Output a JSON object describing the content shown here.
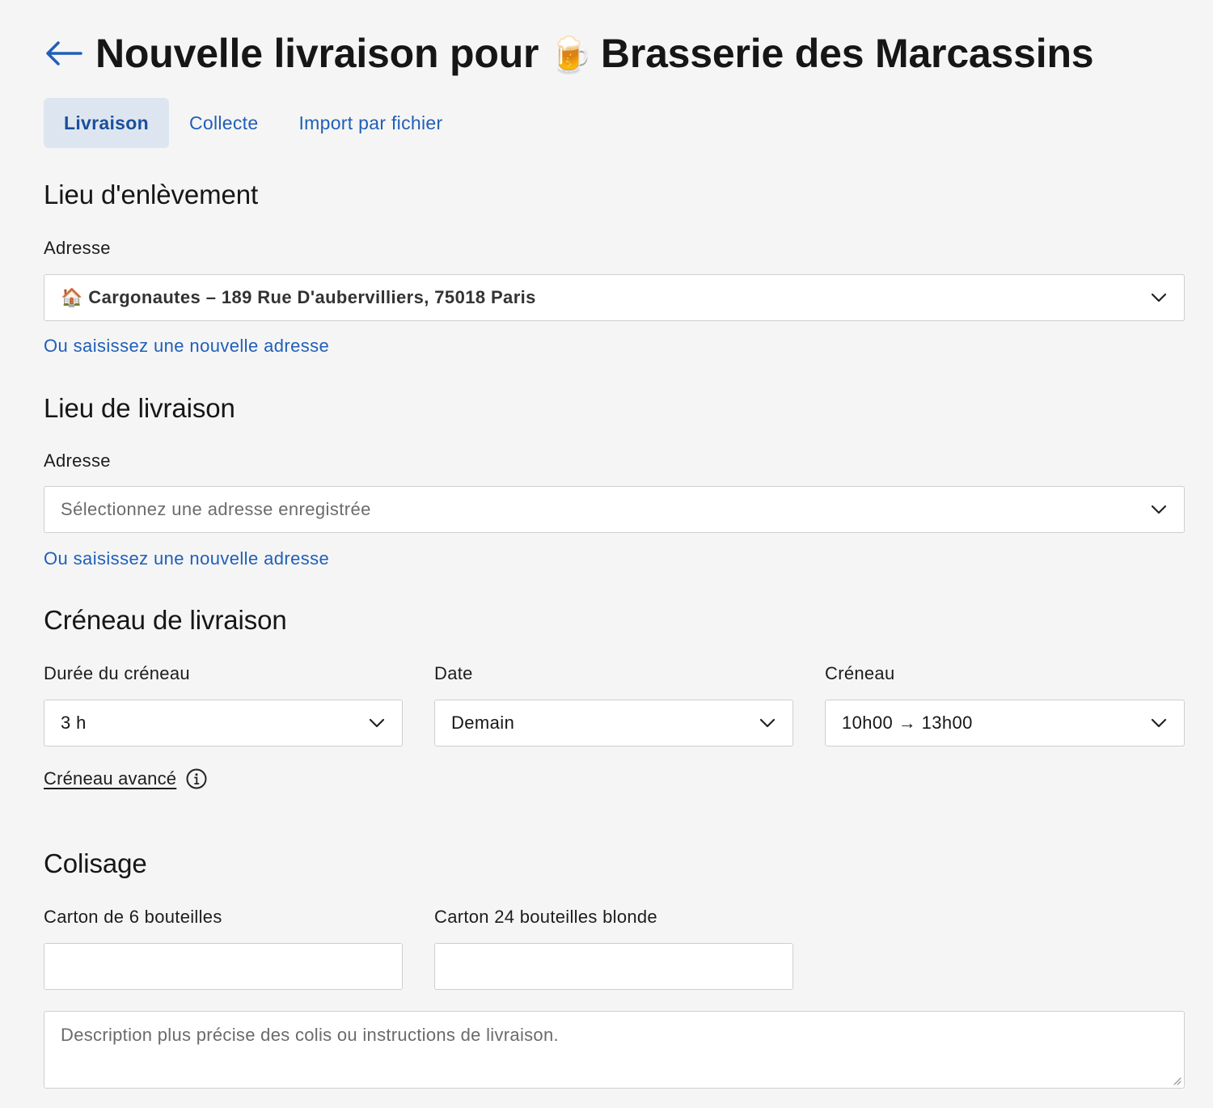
{
  "header": {
    "title_prefix": "Nouvelle livraison pour",
    "title_emoji": "🍺",
    "title_suffix": "Brasserie des Marcassins"
  },
  "tabs": [
    {
      "label": "Livraison",
      "active": true
    },
    {
      "label": "Collecte",
      "active": false
    },
    {
      "label": "Import par fichier",
      "active": false
    }
  ],
  "pickup": {
    "title": "Lieu d'enlèvement",
    "address_label": "Adresse",
    "address_value": "🏠 Cargonautes – 189 Rue D'aubervilliers, 75018 Paris",
    "new_address_link": "Ou saisissez une nouvelle adresse"
  },
  "delivery": {
    "title": "Lieu de livraison",
    "address_label": "Adresse",
    "address_placeholder": "Sélectionnez une adresse enregistrée",
    "new_address_link": "Ou saisissez une nouvelle adresse"
  },
  "slot": {
    "title": "Créneau de livraison",
    "duration_label": "Durée du créneau",
    "duration_value": "3 h",
    "date_label": "Date",
    "date_value": "Demain",
    "slot_label": "Créneau",
    "slot_value": "10h00 → 13h00",
    "advanced_link": "Créneau avancé"
  },
  "packaging": {
    "title": "Colisage",
    "item1_label": "Carton de 6 bouteilles",
    "item1_value": "",
    "item2_label": "Carton 24 bouteilles blonde",
    "item2_value": "",
    "description_placeholder": "Description plus précise des colis ou instructions de livraison."
  },
  "colors": {
    "background": "#f5f5f5",
    "link": "#1f5fb8",
    "active_tab_bg": "#dde6f0",
    "border": "#cfcfcf"
  },
  "icons": {
    "back": "arrow-left-icon",
    "dropdown": "chevron-down-icon",
    "info": "info-icon",
    "resize": "resize-handle-icon"
  }
}
